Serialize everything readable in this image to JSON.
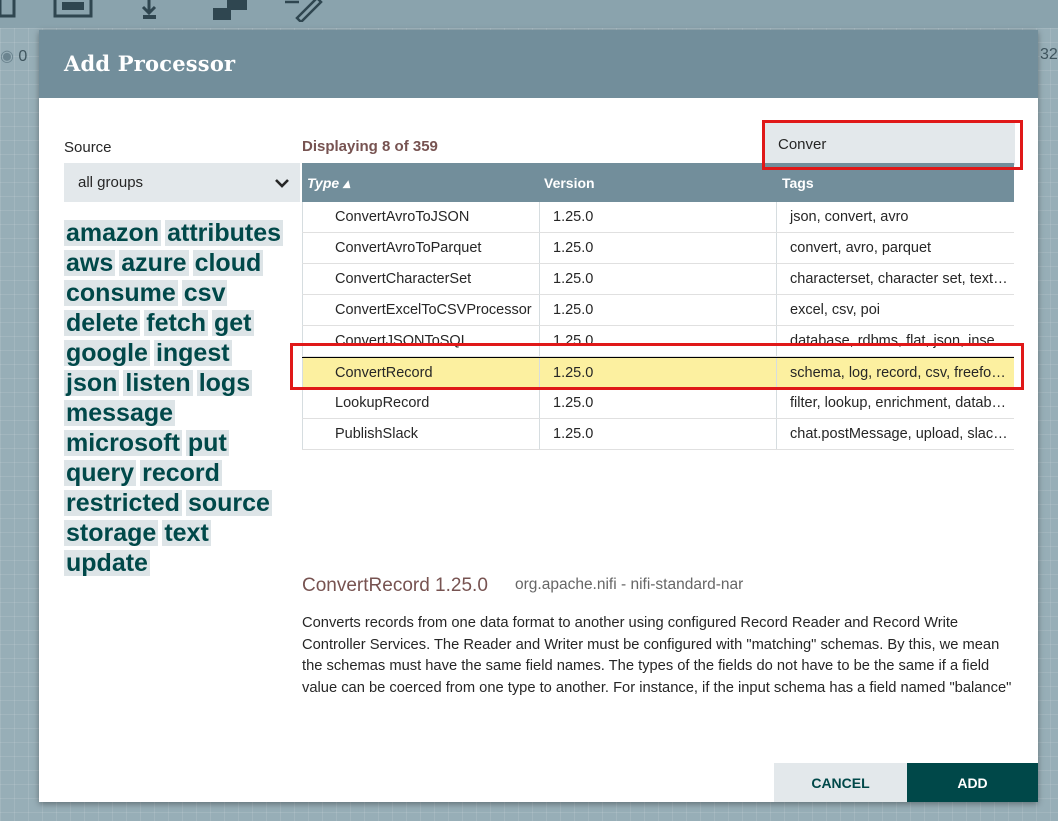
{
  "dialog": {
    "title": "Add Processor",
    "source_label": "Source",
    "source_value": "all groups",
    "displaying": "Displaying 8 of 359",
    "filter_value": "Conver"
  },
  "tags": [
    "amazon",
    "attributes",
    "aws",
    "azure",
    "cloud",
    "consume",
    "csv",
    "delete",
    "fetch",
    "get",
    "google",
    "ingest",
    "json",
    "listen",
    "logs",
    "message",
    "microsoft",
    "put",
    "query",
    "record",
    "restricted",
    "source",
    "storage",
    "text",
    "update"
  ],
  "grid": {
    "headers": {
      "type": "Type ▴",
      "version": "Version",
      "tags": "Tags"
    },
    "rows": [
      {
        "type": "ConvertAvroToJSON",
        "version": "1.25.0",
        "tags": "json, convert, avro"
      },
      {
        "type": "ConvertAvroToParquet",
        "version": "1.25.0",
        "tags": "convert, avro, parquet"
      },
      {
        "type": "ConvertCharacterSet",
        "version": "1.25.0",
        "tags": "characterset, character set, text, encoding"
      },
      {
        "type": "ConvertExcelToCSVProcessor",
        "version": "1.25.0",
        "tags": "excel, csv, poi"
      },
      {
        "type": "ConvertJSONToSQL",
        "version": "1.25.0",
        "tags": "database, rdbms, flat, json, insert, update"
      },
      {
        "type": "ConvertRecord",
        "version": "1.25.0",
        "tags": "schema, log, record, csv, freeform, json"
      },
      {
        "type": "LookupRecord",
        "version": "1.25.0",
        "tags": "filter, lookup, enrichment, database"
      },
      {
        "type": "PublishSlack",
        "version": "1.25.0",
        "tags": "chat.postMessage, upload, slack, conversation"
      }
    ],
    "selected_index": 5
  },
  "details": {
    "title": "ConvertRecord 1.25.0",
    "bundle": "org.apache.nifi - nifi-standard-nar",
    "description": "Converts records from one data format to another using configured Record Reader and Record Write Controller Services. The Reader and Writer must be configured with \"matching\" schemas. By this, we mean the schemas must have the same field names. The types of the fields do not have to be the same if a field value can be coerced from one type to another. For instance, if the input schema has a field named \"balance\" of type double, the output schema can have a field named \"balance\" with a type of string, double, or float."
  },
  "buttons": {
    "cancel": "CANCEL",
    "add": "ADD"
  },
  "background": {
    "stat_left": "0",
    "stat_right": "32"
  },
  "colors": {
    "header": "#728e9b",
    "accent": "#004849",
    "selected_row": "#fcf0a0",
    "highlight": "#e01818",
    "title_brown": "#775351"
  }
}
